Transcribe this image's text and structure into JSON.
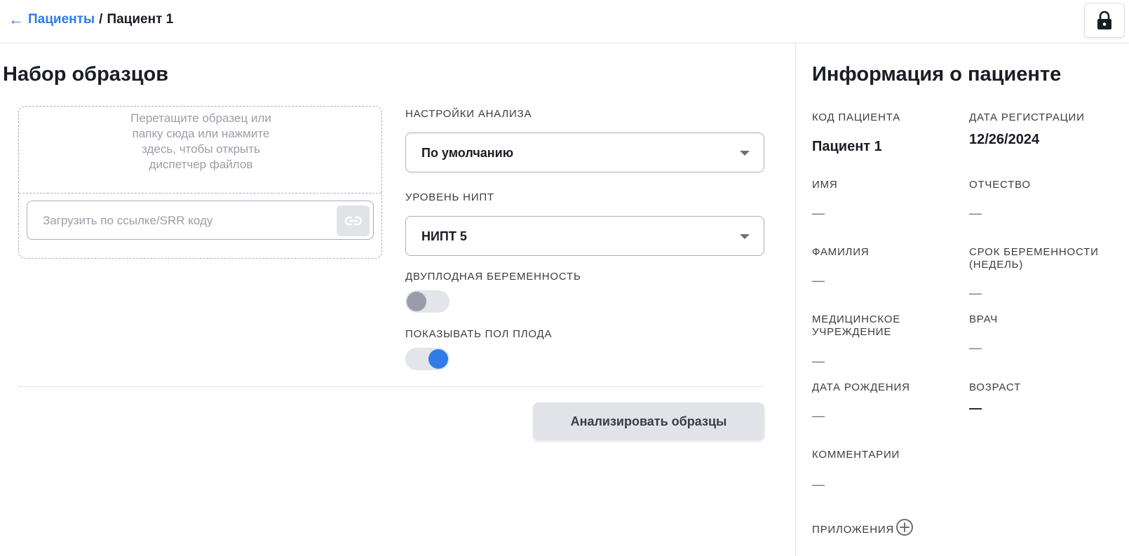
{
  "header": {
    "back_icon": "arrow-left-icon",
    "breadcrumb_parent": "Пациенты",
    "breadcrumb_separator": "/",
    "breadcrumb_current": "Пациент 1",
    "lock_icon": "lock-icon"
  },
  "samples": {
    "title": "Набор образцов",
    "dropzone_text": "Перетащите образец или папку сюда или нажмите здесь, чтобы открыть диспетчер файлов",
    "url_placeholder": "Загрузить по ссылке/SRR коду",
    "link_icon": "link-icon",
    "analysis_settings_label": "Настройки анализа",
    "analysis_settings_value": "По умолчанию",
    "nipt_level_label": "Уровень НИПТ",
    "nipt_level_value": "НИПТ 5",
    "twin_pregnancy_label": "Двуплодная беременность",
    "twin_pregnancy_enabled": false,
    "show_fetal_sex_label": "Показывать пол плода",
    "show_fetal_sex_enabled": true,
    "analyze_button": "Анализировать образцы"
  },
  "patient_info": {
    "title": "Информация о пациенте",
    "patient_code_label": "Код пациента",
    "patient_code_value": "Пациент 1",
    "registration_date_label": "Дата регистрации",
    "registration_date_value": "12/26/2024",
    "first_name_label": "Имя",
    "first_name_value": "—",
    "patronymic_label": "Отчество",
    "patronymic_value": "—",
    "last_name_label": "Фамилия",
    "last_name_value": "—",
    "gestation_label": "Срок беременности (недель)",
    "gestation_value": "—",
    "institution_label": "Медицинское учреждение",
    "institution_value": "—",
    "doctor_label": "Врач",
    "doctor_value": "—",
    "birth_date_label": "Дата рождения",
    "birth_date_value": "—",
    "age_label": "Возраст",
    "age_value": "—",
    "comments_label": "Комментарии",
    "comments_value": "—",
    "attachments_label": "Приложения",
    "attachments_icon": "plus-circle-icon"
  },
  "colors": {
    "accent": "#2f7ce8",
    "toggle_off_knob": "#9a9cab",
    "button_bg": "#e1e3e8"
  }
}
